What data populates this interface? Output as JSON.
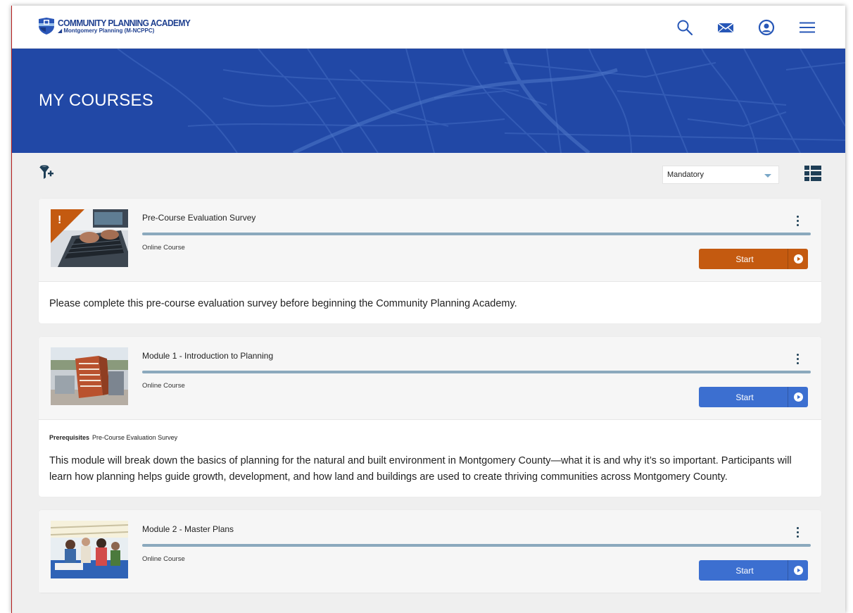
{
  "header": {
    "logo_title": "COMMUNITY PLANNING ACADEMY",
    "logo_subtitle": "Montgomery Planning  (M-NCPPC)",
    "icons": [
      "search-icon",
      "mail-icon",
      "user-circle-icon",
      "hamburger-menu-icon"
    ]
  },
  "banner": {
    "title": "MY COURSES"
  },
  "toolbar": {
    "filter_select_value": "Mandatory",
    "filter_icon": "filter-add-icon",
    "view_icon": "list-view-icon"
  },
  "colors": {
    "primary_blue": "#2148a6",
    "start_orange": "#c45a10",
    "start_blue": "#3c6fd0",
    "progress": "#8ba9bd"
  },
  "courses": [
    {
      "title": "Pre-Course Evaluation Survey",
      "type": "Online Course",
      "action": "Start",
      "alert_mark": "!",
      "description": "Please complete this pre-course evaluation survey before beginning the Community Planning Academy."
    },
    {
      "title": "Module 1 - Introduction to Planning",
      "type": "Online Course",
      "action": "Start",
      "prereq_label": "Prerequisites",
      "prereq_value": "Pre-Course Evaluation Survey",
      "description": "This module will break down the basics of planning for the natural and built environment in Montgomery County—what it is and why it’s so important. Participants will learn how planning helps guide growth, development, and how land and buildings are used to create thriving communities across Montgomery County."
    },
    {
      "title": "Module 2 - Master Plans",
      "type": "Online Course",
      "action": "Start"
    }
  ]
}
